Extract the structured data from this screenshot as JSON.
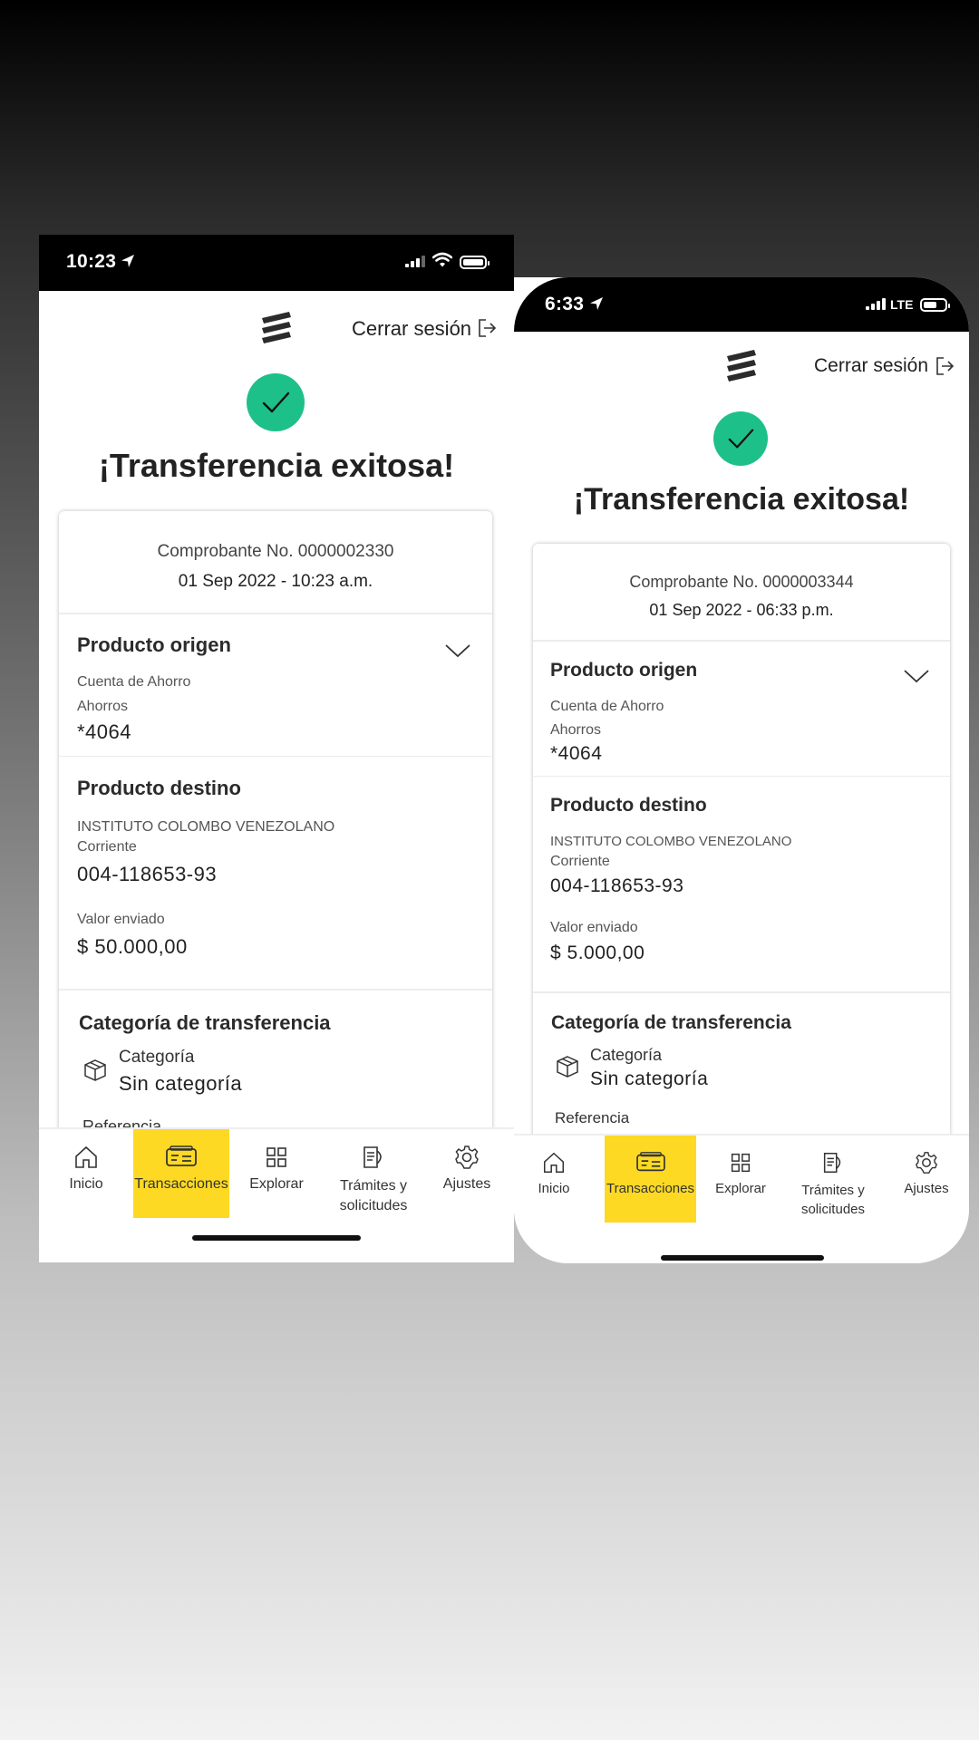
{
  "phones": [
    {
      "status": {
        "time": "10:23"
      },
      "header": {
        "logout_label": "Cerrar sesión"
      },
      "title": "¡Transferencia exitosa!",
      "receipt": {
        "comprobante": "Comprobante No. 0000002330",
        "datetime": "01 Sep 2022 - 10:23 a.m."
      },
      "origin": {
        "heading": "Producto origen",
        "account_type": "Cuenta de Ahorro",
        "subtype": "Ahorros",
        "number": "*4064"
      },
      "destination": {
        "heading": "Producto destino",
        "name": "INSTITUTO COLOMBO VENEZOLANO",
        "type": "Corriente",
        "number": "004-118653-93",
        "amount_label": "Valor enviado",
        "amount": "$ 50.000,00"
      },
      "category": {
        "heading": "Categoría de transferencia",
        "label": "Categoría",
        "value": "Sin categoría",
        "reference_label": "Referencia"
      },
      "nav": [
        "Inicio",
        "Transacciones",
        "Explorar",
        "Trámites y solicitudes",
        "Ajustes"
      ]
    },
    {
      "status": {
        "time": "6:33",
        "network": "LTE"
      },
      "header": {
        "logout_label": "Cerrar sesión"
      },
      "title": "¡Transferencia exitosa!",
      "receipt": {
        "comprobante": "Comprobante No. 0000003344",
        "datetime": "01 Sep 2022 - 06:33 p.m."
      },
      "origin": {
        "heading": "Producto origen",
        "account_type": "Cuenta de Ahorro",
        "subtype": "Ahorros",
        "number": "*4064"
      },
      "destination": {
        "heading": "Producto destino",
        "name": "INSTITUTO COLOMBO VENEZOLANO",
        "type": "Corriente",
        "number": "004-118653-93",
        "amount_label": "Valor enviado",
        "amount": "$ 5.000,00"
      },
      "category": {
        "heading": "Categoría de transferencia",
        "label": "Categoría",
        "value": "Sin categoría",
        "reference_label": "Referencia"
      },
      "nav": [
        "Inicio",
        "Transacciones",
        "Explorar",
        "Trámites y solicitudes",
        "Ajustes"
      ]
    }
  ],
  "active_nav": "Transacciones",
  "colors": {
    "success": "#1ec08a",
    "accent": "#fdd923",
    "status_bar": "#000000"
  }
}
